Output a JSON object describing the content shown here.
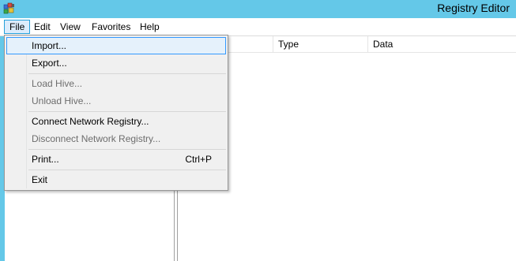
{
  "window": {
    "title": "Registry Editor",
    "app_icon": "registry-editor-icon"
  },
  "menubar": {
    "items": [
      "File",
      "Edit",
      "View",
      "Favorites",
      "Help"
    ],
    "active": "File"
  },
  "list_view": {
    "columns": [
      "",
      "Type",
      "Data"
    ]
  },
  "file_menu": {
    "items": [
      {
        "label": "Import...",
        "enabled": true,
        "highlighted": true
      },
      {
        "label": "Export...",
        "enabled": true
      },
      {
        "label": "Load Hive...",
        "enabled": false
      },
      {
        "label": "Unload Hive...",
        "enabled": false
      },
      {
        "label": "Connect Network Registry...",
        "enabled": true
      },
      {
        "label": "Disconnect Network Registry...",
        "enabled": false
      },
      {
        "label": "Print...",
        "shortcut": "Ctrl+P",
        "enabled": true
      },
      {
        "label": "Exit",
        "enabled": true
      }
    ]
  },
  "colors": {
    "titlebar": "#64c8e8",
    "menu_highlight_border": "#3399ff",
    "menu_highlight_fill": "#e5f1fb",
    "disabled_text": "#6d6d6d"
  }
}
